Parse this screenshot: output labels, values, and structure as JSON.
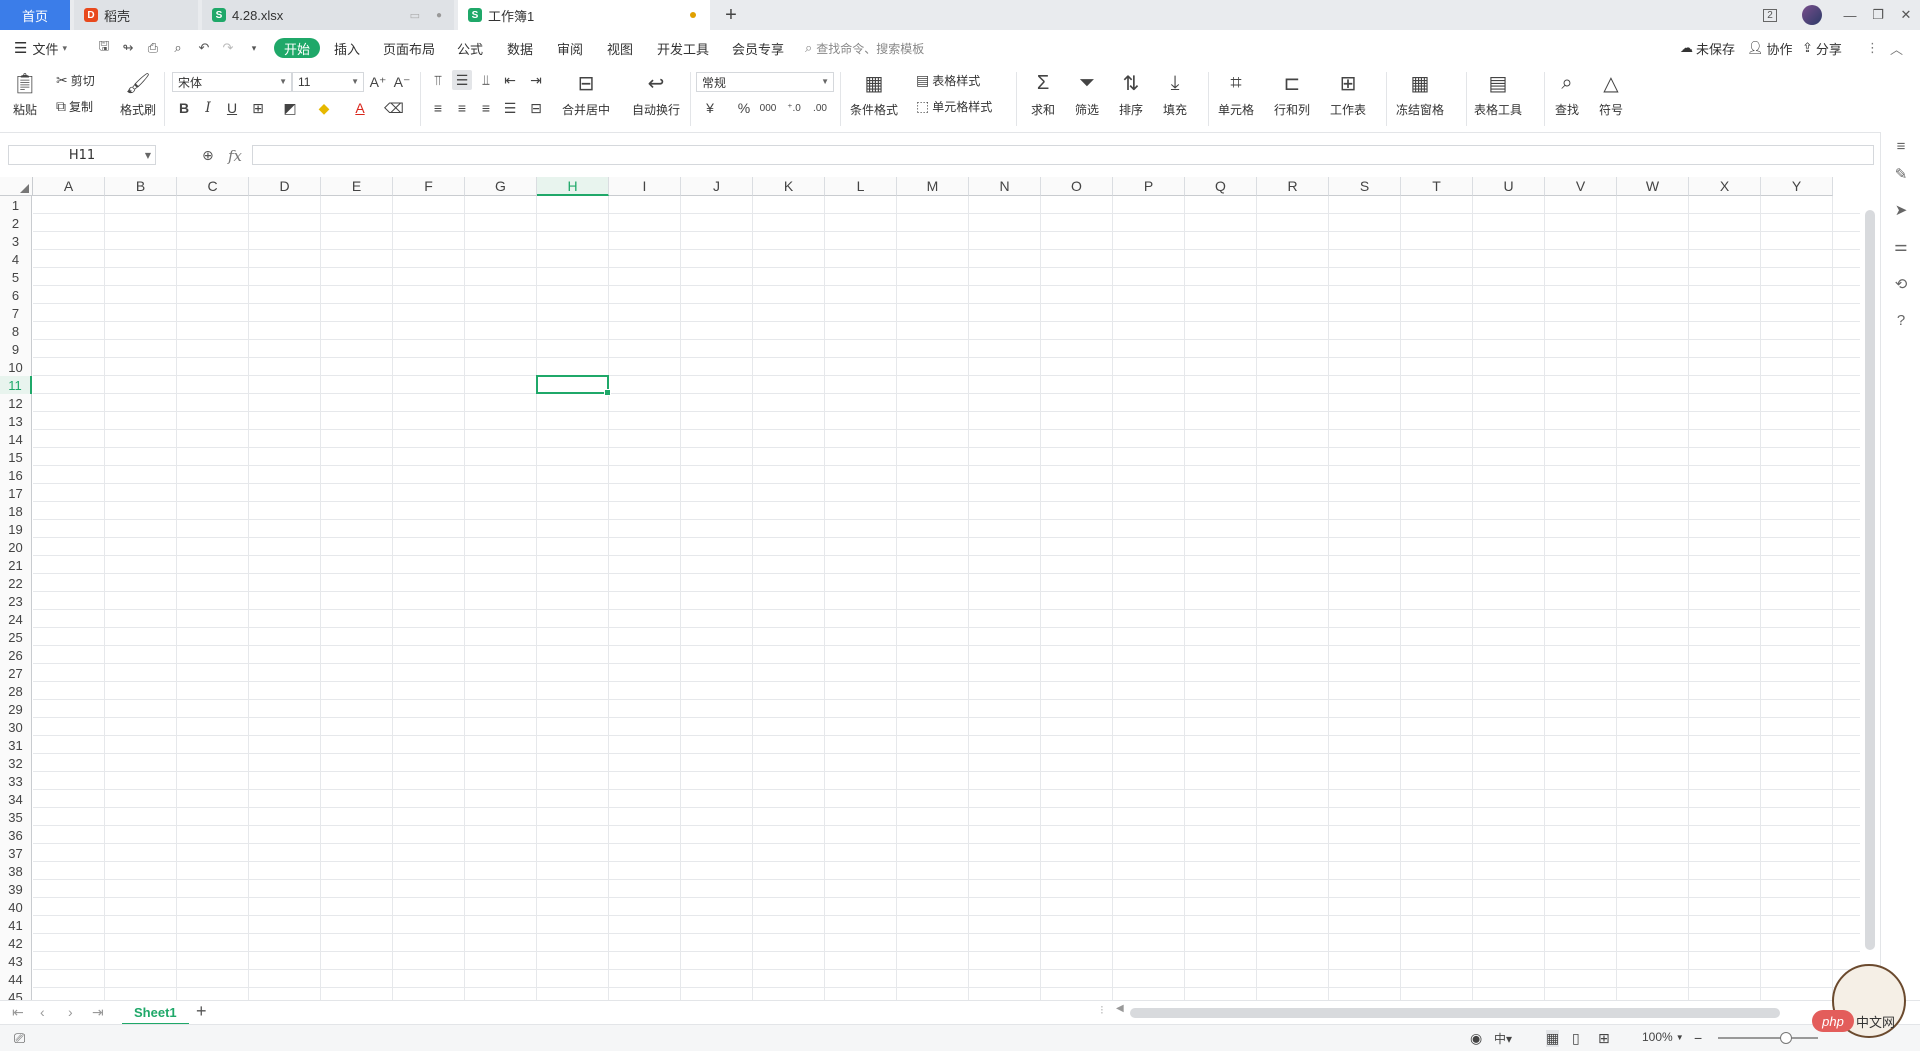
{
  "tabs": {
    "home": "首页",
    "daoke": "稻壳",
    "file1": "4.28.xlsx",
    "book": "工作簿1"
  },
  "window": {
    "badge": "2"
  },
  "menu": {
    "file": "文件",
    "items": [
      "开始",
      "插入",
      "页面布局",
      "公式",
      "数据",
      "审阅",
      "视图",
      "开发工具",
      "会员专享"
    ],
    "search_placeholder": "查找命令、搜索模板",
    "unsaved": "未保存",
    "collab": "协作",
    "share": "分享"
  },
  "ribbon": {
    "paste": "粘贴",
    "cut": "剪切",
    "copy": "复制",
    "format_painter": "格式刷",
    "font_name": "宋体",
    "font_size": "11",
    "merge_center": "合并居中",
    "wrap": "自动换行",
    "number_format": "常规",
    "currency": "¥",
    "percent": "%",
    "thousands": "000",
    "cond_format": "条件格式",
    "table_style": "表格样式",
    "cell_style": "单元格样式",
    "sum": "求和",
    "filter": "筛选",
    "sort": "排序",
    "fill": "填充",
    "cell": "单元格",
    "row_col": "行和列",
    "worksheet": "工作表",
    "freeze": "冻结窗格",
    "table_tools": "表格工具",
    "find": "查找",
    "symbol": "符号"
  },
  "formula_bar": {
    "name_box": "H11",
    "fx": "fx",
    "content": ""
  },
  "grid": {
    "columns": [
      "A",
      "B",
      "C",
      "D",
      "E",
      "F",
      "G",
      "H",
      "I",
      "J",
      "K",
      "L",
      "M",
      "N",
      "O",
      "P",
      "Q",
      "R",
      "S",
      "T",
      "U",
      "V",
      "W",
      "X",
      "Y"
    ],
    "rows": [
      "1",
      "2",
      "3",
      "4",
      "5",
      "6",
      "7",
      "8",
      "9",
      "10",
      "11",
      "12",
      "13",
      "14",
      "15",
      "16",
      "17",
      "18",
      "19",
      "20",
      "21",
      "22",
      "23",
      "24",
      "25",
      "26",
      "27",
      "28",
      "29",
      "30",
      "31",
      "32",
      "33",
      "34",
      "35",
      "36",
      "37",
      "38",
      "39",
      "40",
      "41",
      "42",
      "43",
      "44",
      "45"
    ],
    "selected_col": "H",
    "selected_row": "11"
  },
  "sheets": {
    "active": "Sheet1"
  },
  "status": {
    "zoom": "100%",
    "mascot_text": "中文网",
    "mascot_brand": "php"
  },
  "colors": {
    "accent": "#1fa869",
    "tab_home": "#3b7de9"
  }
}
